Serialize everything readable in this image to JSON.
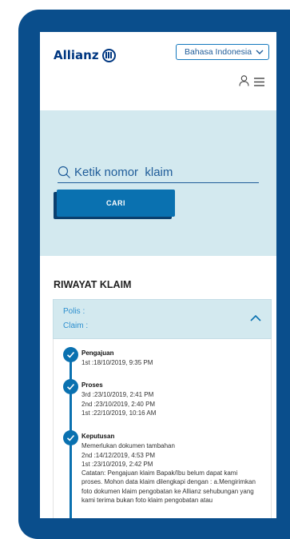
{
  "header": {
    "logo_text": "Allianz",
    "language_label": "Bahasa Indonesia"
  },
  "search": {
    "placeholder": "Ketik nomor  klaim",
    "button_label": "CARI"
  },
  "history": {
    "title": "RIWAYAT KLAIM",
    "polis_label": "Polis :",
    "claim_label": "Claim :",
    "steps": [
      {
        "title": "Pengajuan",
        "lines": [
          "1st :18/10/2019, 9:35 PM"
        ]
      },
      {
        "title": "Proses",
        "lines": [
          "3rd :23/10/2019, 2:41 PM",
          "2nd :23/10/2019, 2:40 PM",
          "1st :22/10/2019, 10:16 AM"
        ]
      },
      {
        "title": "Keputusan",
        "lines": [
          "Memerlukan dokumen tambahan",
          "2nd :14/12/2019, 4:53 PM",
          "1st :23/10/2019, 2:42 PM",
          "Catatan: Pengajuan klaim Bapak/Ibu belum dapat kami",
          "proses. Mohon data klaim dilengkapi dengan : a.Mengirimkan",
          "foto dokumen klaim pengobatan ke Allianz sehubungan yang",
          "kami terima bukan foto klaim pengobatan atau"
        ]
      }
    ]
  },
  "colors": {
    "frame": "#0a4e8c",
    "brand_blue": "#003781",
    "accent": "#0a71b0",
    "search_bg": "#d3e9ef"
  }
}
